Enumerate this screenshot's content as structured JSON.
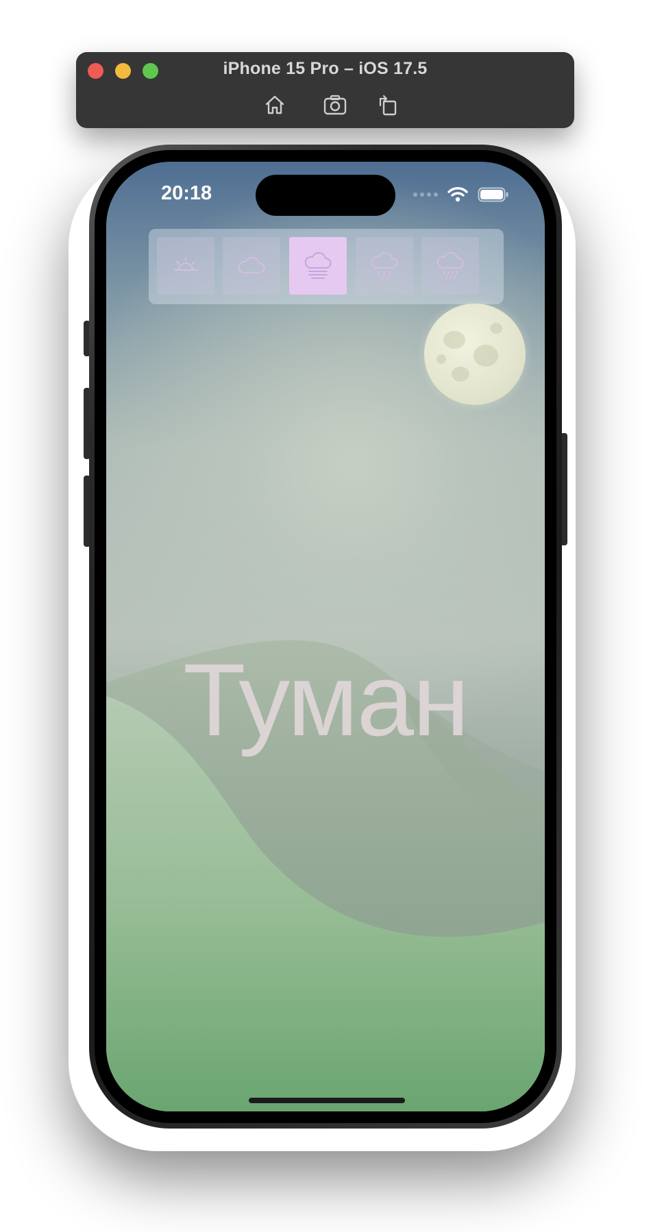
{
  "simulator": {
    "title": "iPhone 15 Pro – iOS 17.5",
    "toolbar_icons": [
      "home-icon",
      "screenshot-icon",
      "rotate-icon"
    ]
  },
  "status_bar": {
    "time": "20:18",
    "icons": [
      "cellular-signal-icon",
      "wifi-icon",
      "battery-icon"
    ]
  },
  "weather_selector": {
    "options": [
      {
        "icon": "sun-icon",
        "selected": false
      },
      {
        "icon": "cloud-icon",
        "selected": false
      },
      {
        "icon": "fog-icon",
        "selected": true
      },
      {
        "icon": "rain-icon",
        "selected": false
      },
      {
        "icon": "hail-icon",
        "selected": false
      }
    ]
  },
  "main": {
    "condition": "Туман"
  },
  "colors": {
    "selected_segment": "#e6c9f1",
    "icon_tint": "#d8b2ea",
    "condition_text": "#e0d6d8"
  }
}
